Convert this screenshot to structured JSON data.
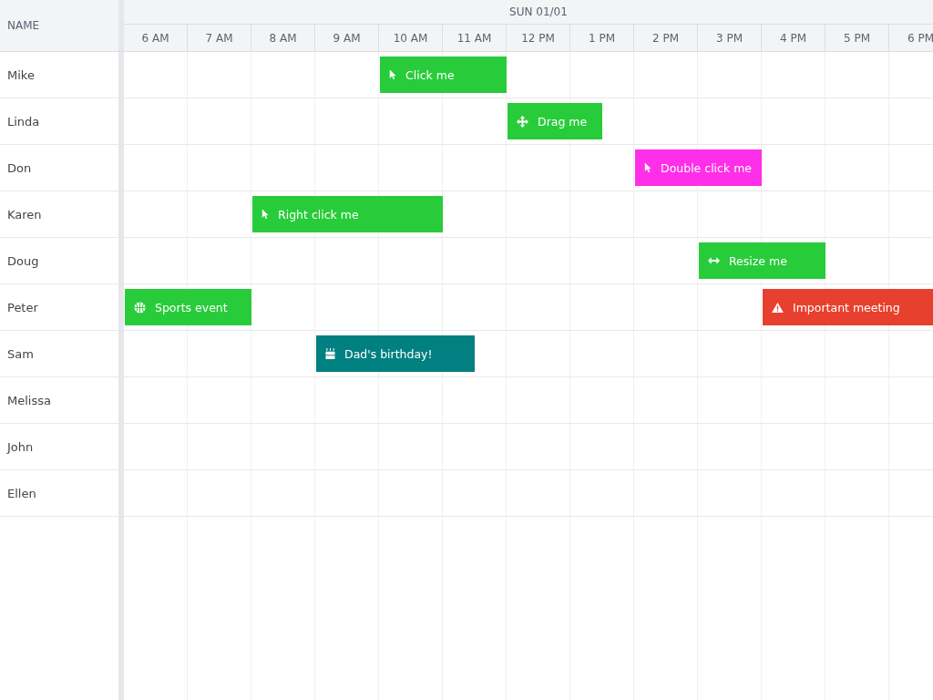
{
  "name_column": {
    "heading": "NAME"
  },
  "day": "SUN 01/01",
  "hours": [
    "6 AM",
    "7 AM",
    "8 AM",
    "9 AM",
    "10 AM",
    "11 AM",
    "12 PM",
    "1 PM",
    "2 PM",
    "3 PM",
    "4 PM",
    "5 PM",
    "6 PM"
  ],
  "resources": [
    {
      "name": "Mike",
      "events": [
        {
          "label": "Click me",
          "kind": "pointer",
          "color": "#28cc3a"
        }
      ]
    },
    {
      "name": "Linda",
      "events": [
        {
          "label": "Drag me",
          "kind": "move",
          "color": "#28cc3a"
        }
      ]
    },
    {
      "name": "Don",
      "events": [
        {
          "label": "Double click me",
          "kind": "pointer",
          "color": "#ff2ee8"
        }
      ]
    },
    {
      "name": "Karen",
      "events": [
        {
          "label": "Right click me",
          "kind": "pointer",
          "color": "#28cc3a"
        }
      ]
    },
    {
      "name": "Doug",
      "events": [
        {
          "label": "Resize me",
          "kind": "resize",
          "color": "#28cc3a"
        }
      ]
    },
    {
      "name": "Peter",
      "events": [
        {
          "label": "Sports event",
          "kind": "ball",
          "color": "#28cc3a"
        },
        {
          "label": "Important meeting",
          "kind": "warning",
          "color": "#e8402e"
        }
      ]
    },
    {
      "name": "Sam",
      "events": [
        {
          "label": "Dad's birthday!",
          "kind": "cake",
          "color": "#008080"
        }
      ]
    },
    {
      "name": "Melissa"
    },
    {
      "name": "John"
    },
    {
      "name": "Ellen"
    }
  ]
}
